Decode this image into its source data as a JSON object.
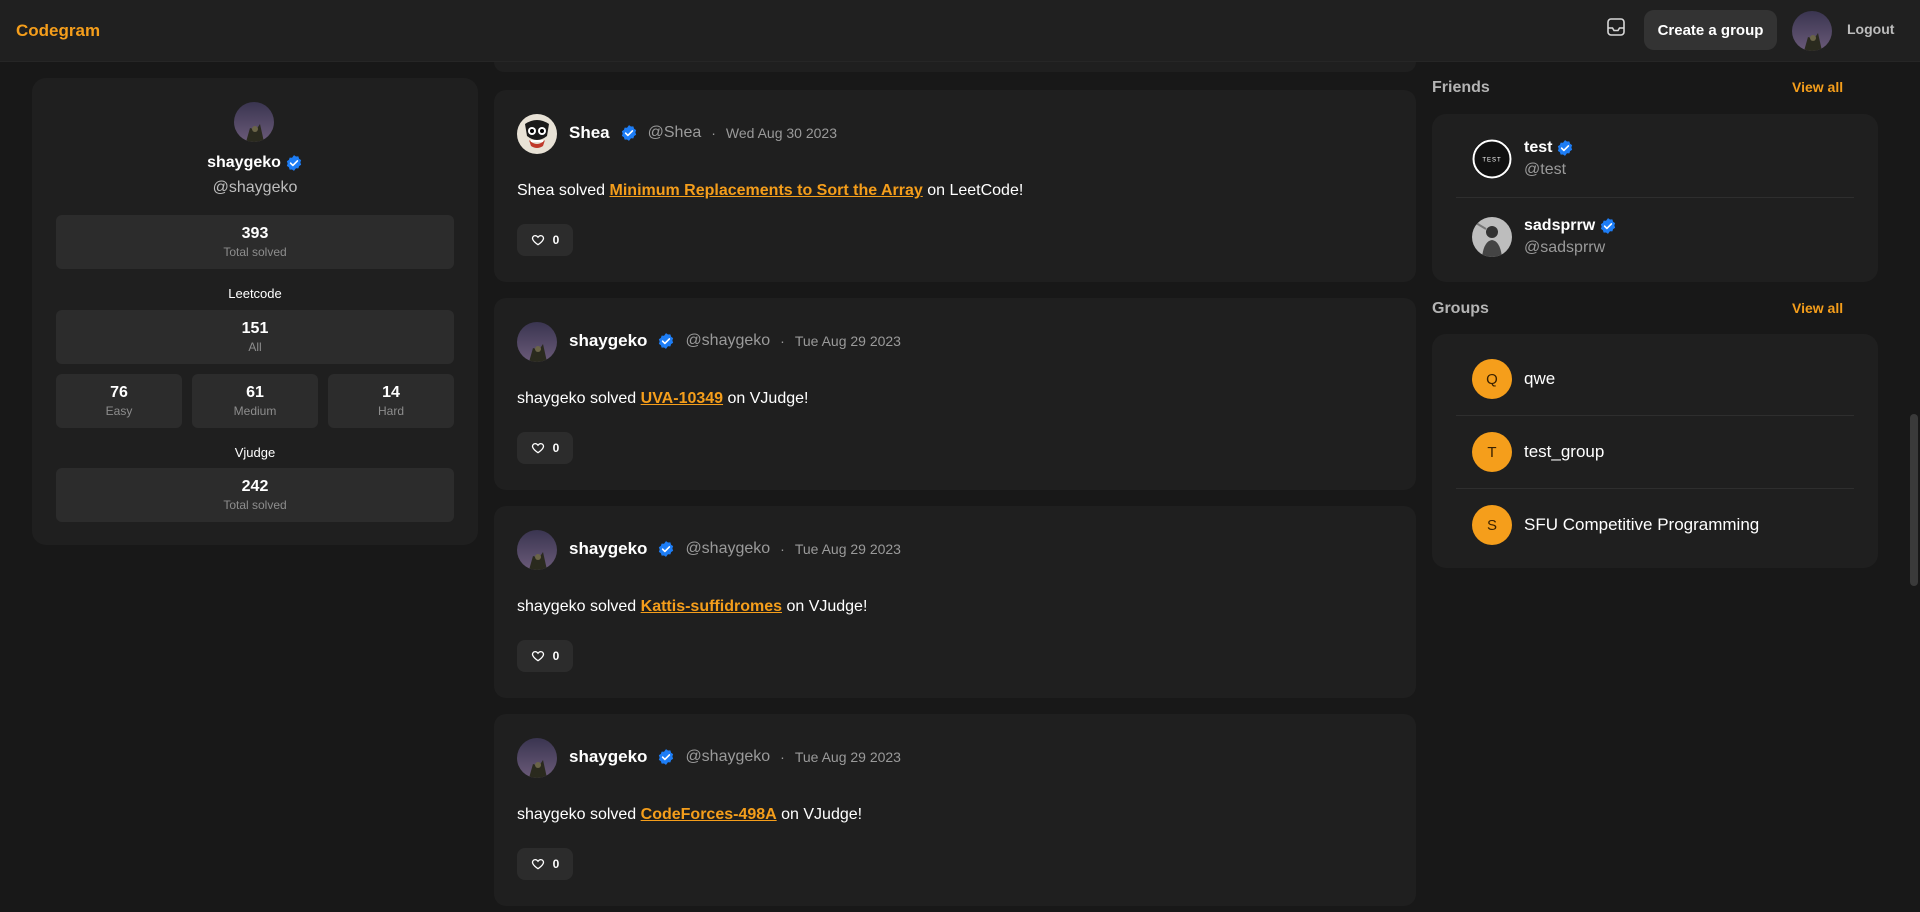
{
  "header": {
    "brand": "Codegram",
    "create_group_label": "Create a group",
    "logout_label": "Logout"
  },
  "profile": {
    "name": "shaygeko",
    "handle": "@shaygeko",
    "total": {
      "value": "393",
      "label": "Total solved"
    },
    "leetcode_label": "Leetcode",
    "leetcode_all": {
      "value": "151",
      "label": "All"
    },
    "easy": {
      "value": "76",
      "label": "Easy"
    },
    "medium": {
      "value": "61",
      "label": "Medium"
    },
    "hard": {
      "value": "14",
      "label": "Hard"
    },
    "vjudge_label": "Vjudge",
    "vjudge_total": {
      "value": "242",
      "label": "Total solved"
    }
  },
  "posts": [
    {
      "name": "Shea",
      "handle": "@Shea",
      "date": "Wed Aug 30 2023",
      "subject": "Shea solved ",
      "problem": "Minimum Replacements to Sort the Array",
      "suffix": " on LeetCode!",
      "likes": "0"
    },
    {
      "name": "shaygeko",
      "handle": "@shaygeko",
      "date": "Tue Aug 29 2023",
      "subject": "shaygeko solved ",
      "problem": "UVA-10349",
      "suffix": " on VJudge!",
      "likes": "0"
    },
    {
      "name": "shaygeko",
      "handle": "@shaygeko",
      "date": "Tue Aug 29 2023",
      "subject": "shaygeko solved ",
      "problem": "Kattis-suffidromes",
      "suffix": " on VJudge!",
      "likes": "0"
    },
    {
      "name": "shaygeko",
      "handle": "@shaygeko",
      "date": "Tue Aug 29 2023",
      "subject": "shaygeko solved ",
      "problem": "CodeForces-498A",
      "suffix": " on VJudge!",
      "likes": "0"
    }
  ],
  "post_separator": "·",
  "friends": {
    "title": "Friends",
    "view_all": "View all",
    "items": [
      {
        "name": "test",
        "handle": "@test",
        "avatar_text": "TEST"
      },
      {
        "name": "sadsprrw",
        "handle": "@sadsprrw"
      }
    ]
  },
  "groups": {
    "title": "Groups",
    "view_all": "View all",
    "items": [
      {
        "initial": "Q",
        "name": "qwe"
      },
      {
        "initial": "T",
        "name": "test_group"
      },
      {
        "initial": "S",
        "name": "SFU Competitive Programming"
      }
    ]
  },
  "colors": {
    "accent": "#f59e1b",
    "verified": "#1d7df5",
    "background": "#181818",
    "card": "#1f1f1f"
  },
  "icons": [
    "inbox-icon",
    "verified-badge-icon",
    "heart-icon"
  ]
}
